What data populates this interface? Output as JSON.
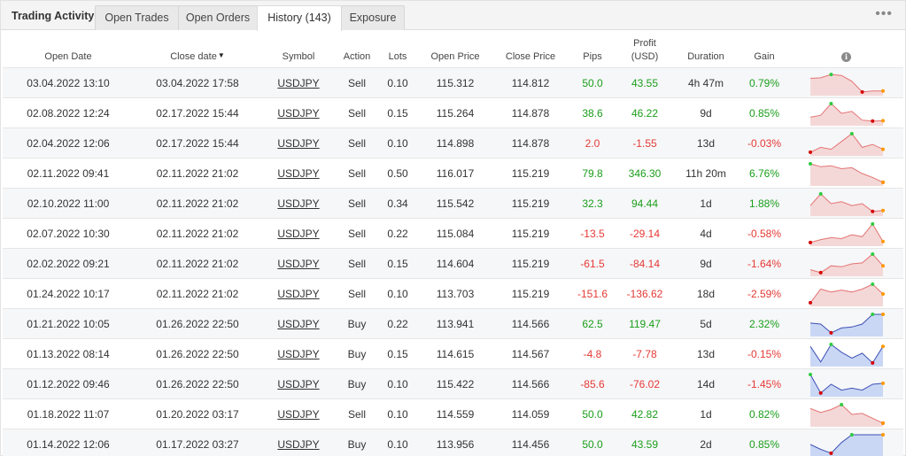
{
  "tabs": {
    "title": "Trading Activity",
    "items": [
      {
        "label": "Open Trades"
      },
      {
        "label": "Open Orders"
      },
      {
        "label": "History (143)"
      },
      {
        "label": "Exposure"
      }
    ],
    "more": "•••"
  },
  "columns": {
    "open_date": "Open Date",
    "close_date": "Close date",
    "symbol": "Symbol",
    "action": "Action",
    "lots": "Lots",
    "open_price": "Open Price",
    "close_price": "Close Price",
    "pips": "Pips",
    "profit_l1": "Profit",
    "profit_l2": "(USD)",
    "duration": "Duration",
    "gain": "Gain",
    "info": "i"
  },
  "colors": {
    "positive": "#1a9e1a",
    "negative": "#e53935",
    "sell_line": "#e57373",
    "sell_fill": "#f4d8d8",
    "buy_line": "#3f51b5",
    "buy_fill": "#c9d7f5",
    "dot_high": "#2ecc40",
    "dot_low": "#d50000",
    "dot_end": "#ff9800"
  },
  "rows": [
    {
      "open_date": "03.04.2022 13:10",
      "close_date": "03.04.2022 17:58",
      "symbol": "USDJPY",
      "action": "Sell",
      "lots": "0.10",
      "open_price": "115.312",
      "close_price": "114.812",
      "pips": "50.0",
      "profit": "43.55",
      "duration": "4h 47m",
      "gain": "0.79%",
      "sign": "pos",
      "spark": [
        0.75,
        0.78,
        0.95,
        0.9,
        0.6,
        0.05,
        0.1,
        0.1
      ]
    },
    {
      "open_date": "02.08.2022 12:24",
      "close_date": "02.17.2022 15:44",
      "symbol": "USDJPY",
      "action": "Sell",
      "lots": "0.15",
      "open_price": "115.264",
      "close_price": "114.878",
      "pips": "38.6",
      "profit": "46.22",
      "duration": "9d",
      "gain": "0.85%",
      "sign": "pos",
      "spark": [
        0.3,
        0.4,
        1.0,
        0.5,
        0.6,
        0.15,
        0.1,
        0.12
      ]
    },
    {
      "open_date": "02.04.2022 12:06",
      "close_date": "02.17.2022 15:44",
      "symbol": "USDJPY",
      "action": "Sell",
      "lots": "0.10",
      "open_price": "114.898",
      "close_price": "114.878",
      "pips": "2.0",
      "profit": "-1.55",
      "duration": "13d",
      "gain": "-0.03%",
      "sign": "neg",
      "spark": [
        0.05,
        0.3,
        0.2,
        0.6,
        1.0,
        0.3,
        0.45,
        0.2
      ]
    },
    {
      "open_date": "02.11.2022 09:41",
      "close_date": "02.11.2022 21:02",
      "symbol": "USDJPY",
      "action": "Sell",
      "lots": "0.50",
      "open_price": "116.017",
      "close_price": "115.219",
      "pips": "79.8",
      "profit": "346.30",
      "duration": "11h 20m",
      "gain": "6.76%",
      "sign": "pos",
      "spark": [
        1.0,
        0.85,
        0.9,
        0.75,
        0.8,
        0.5,
        0.3,
        0.05
      ]
    },
    {
      "open_date": "02.10.2022 11:00",
      "close_date": "02.11.2022 21:02",
      "symbol": "USDJPY",
      "action": "Sell",
      "lots": "0.34",
      "open_price": "115.542",
      "close_price": "115.219",
      "pips": "32.3",
      "profit": "94.44",
      "duration": "1d",
      "gain": "1.88%",
      "sign": "pos",
      "spark": [
        0.4,
        1.0,
        0.5,
        0.6,
        0.4,
        0.5,
        0.1,
        0.15
      ]
    },
    {
      "open_date": "02.07.2022 10:30",
      "close_date": "02.11.2022 21:02",
      "symbol": "USDJPY",
      "action": "Sell",
      "lots": "0.22",
      "open_price": "115.084",
      "close_price": "115.219",
      "pips": "-13.5",
      "profit": "-29.14",
      "duration": "4d",
      "gain": "-0.58%",
      "sign": "neg",
      "spark": [
        0.05,
        0.2,
        0.3,
        0.25,
        0.45,
        0.35,
        1.0,
        0.1
      ]
    },
    {
      "open_date": "02.02.2022 09:21",
      "close_date": "02.11.2022 21:02",
      "symbol": "USDJPY",
      "action": "Sell",
      "lots": "0.15",
      "open_price": "114.604",
      "close_price": "115.219",
      "pips": "-61.5",
      "profit": "-84.14",
      "duration": "9d",
      "gain": "-1.64%",
      "sign": "neg",
      "spark": [
        0.2,
        0.05,
        0.4,
        0.35,
        0.5,
        0.55,
        1.0,
        0.4
      ]
    },
    {
      "open_date": "01.24.2022 10:17",
      "close_date": "02.11.2022 21:02",
      "symbol": "USDJPY",
      "action": "Sell",
      "lots": "0.10",
      "open_price": "113.703",
      "close_price": "115.219",
      "pips": "-151.6",
      "profit": "-136.62",
      "duration": "18d",
      "gain": "-2.59%",
      "sign": "neg",
      "spark": [
        0.05,
        0.75,
        0.6,
        0.7,
        0.6,
        0.75,
        1.0,
        0.5
      ]
    },
    {
      "open_date": "01.21.2022 10:05",
      "close_date": "01.26.2022 22:50",
      "symbol": "USDJPY",
      "action": "Buy",
      "lots": "0.22",
      "open_price": "113.941",
      "close_price": "114.566",
      "pips": "62.5",
      "profit": "119.47",
      "duration": "5d",
      "gain": "2.32%",
      "sign": "pos",
      "spark": [
        0.55,
        0.5,
        0.05,
        0.3,
        0.35,
        0.5,
        1.0,
        1.0
      ]
    },
    {
      "open_date": "01.13.2022 08:14",
      "close_date": "01.26.2022 22:50",
      "symbol": "USDJPY",
      "action": "Buy",
      "lots": "0.15",
      "open_price": "114.615",
      "close_price": "114.567",
      "pips": "-4.8",
      "profit": "-7.78",
      "duration": "13d",
      "gain": "-0.15%",
      "sign": "neg",
      "spark": [
        0.9,
        0.1,
        1.0,
        0.6,
        0.3,
        0.55,
        0.05,
        0.9
      ]
    },
    {
      "open_date": "01.12.2022 09:46",
      "close_date": "01.26.2022 22:50",
      "symbol": "USDJPY",
      "action": "Buy",
      "lots": "0.10",
      "open_price": "115.422",
      "close_price": "114.566",
      "pips": "-85.6",
      "profit": "-76.02",
      "duration": "14d",
      "gain": "-1.45%",
      "sign": "neg",
      "spark": [
        1.0,
        0.05,
        0.5,
        0.2,
        0.3,
        0.2,
        0.5,
        0.55
      ]
    },
    {
      "open_date": "01.18.2022 11:07",
      "close_date": "01.20.2022 03:17",
      "symbol": "USDJPY",
      "action": "Sell",
      "lots": "0.10",
      "open_price": "114.559",
      "close_price": "114.059",
      "pips": "50.0",
      "profit": "42.82",
      "duration": "1d",
      "gain": "0.82%",
      "sign": "pos",
      "spark": [
        0.8,
        0.6,
        0.75,
        1.0,
        0.5,
        0.55,
        0.3,
        0.05
      ]
    },
    {
      "open_date": "01.14.2022 12:06",
      "close_date": "01.17.2022 03:27",
      "symbol": "USDJPY",
      "action": "Buy",
      "lots": "0.10",
      "open_price": "113.956",
      "close_price": "114.456",
      "pips": "50.0",
      "profit": "43.59",
      "duration": "2d",
      "gain": "0.85%",
      "sign": "pos",
      "spark": [
        0.5,
        0.25,
        0.05,
        0.6,
        1.0,
        1.0,
        1.0,
        1.0
      ]
    }
  ]
}
